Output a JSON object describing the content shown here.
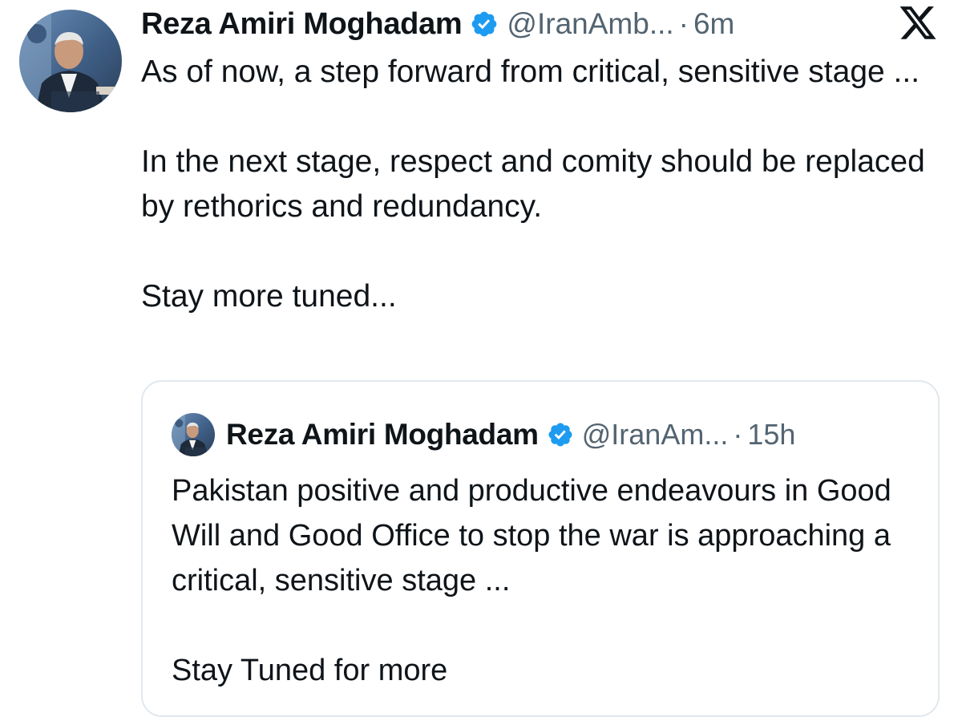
{
  "tweet": {
    "author_name": "Reza Amiri Moghadam",
    "handle": "@IranAmb...",
    "separator": "·",
    "time": "6m",
    "avatar_icon": "profile-photo",
    "verified_icon": "verified-badge-icon",
    "platform_icon": "x-logo-icon",
    "paragraphs": [
      "As of now, a step forward from critical, sensitive stage ...",
      "In the next stage, respect and comity should be replaced by rethorics and redundancy.",
      "Stay more tuned..."
    ]
  },
  "quoted_tweet": {
    "author_name": "Reza Amiri Moghadam",
    "handle": "@IranAm...",
    "separator": "·",
    "time": "15h",
    "paragraphs": [
      "Pakistan positive and productive endeavours in Good Will and Good Office to stop the war is approaching a critical, sensitive stage ...",
      "Stay Tuned for more"
    ]
  },
  "colors": {
    "text": "#0f1419",
    "secondary_text": "#536471",
    "verified_blue": "#1d9bf0",
    "border": "#e1e8ed"
  }
}
